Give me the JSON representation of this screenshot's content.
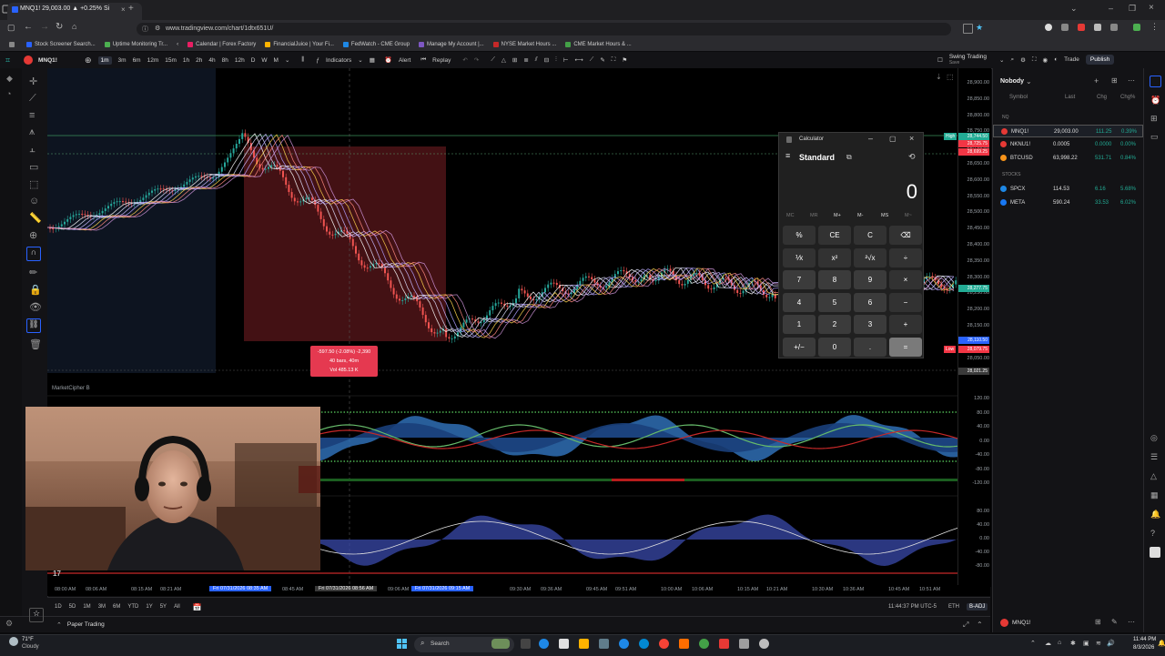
{
  "browser": {
    "tab_title": "MNQ1! 29,003.00 ▲ +0.25% Si",
    "url": "www.tradingview.com/chart/1dtx651U/",
    "bookmarks": [
      "Stock Screener Search...",
      "Uptime Monitoring Tr...",
      "Calendar | Forex Factory",
      "FinancialJuice | Your Fi...",
      "FedWatch - CME Group",
      "Manage My Account |...",
      "NYSE Market Hours ...",
      "CME Market Hours & ..."
    ],
    "bookmark_colors": [
      "#2962ff",
      "#4caf50",
      "#e91e63",
      "#ffb300",
      "#1e88e5",
      "#7e57c2",
      "#c62828",
      "#43a047"
    ]
  },
  "toolbar": {
    "symbol": "MNQ1!",
    "intervals": [
      "1m",
      "3m",
      "6m",
      "12m",
      "15m",
      "1h",
      "2h",
      "4h",
      "8h",
      "12h",
      "D",
      "W",
      "M"
    ],
    "indicators_label": "Indicators",
    "alert_label": "Alert",
    "replay_label": "Replay",
    "layout_name": "Swing Trading",
    "layout_sub": "Save",
    "trade_label": "Trade",
    "publish_label": "Publish"
  },
  "chart": {
    "price_ticks": [
      "28,900.00",
      "28,850.00",
      "28,800.00",
      "28,750.00",
      "28,700.00",
      "28,650.00",
      "28,600.00",
      "28,550.00",
      "28,500.00",
      "28,450.00",
      "28,400.00",
      "28,350.00",
      "28,300.00",
      "28,250.00",
      "28,200.00",
      "28,150.00",
      "28,100.00",
      "28,050.00"
    ],
    "price_badges": [
      {
        "text": "28,744.50",
        "color": "#22ab94",
        "label": "High"
      },
      {
        "text": "28,725.75",
        "color": "#f23645",
        "label": ""
      },
      {
        "text": "28,699.25",
        "color": "#f23645",
        "label": ""
      },
      {
        "text": "28,277.75",
        "color": "#22ab94",
        "label": ""
      },
      {
        "text": "28,110.50",
        "color": "#2962ff",
        "label": ""
      },
      {
        "text": "28,079.75",
        "color": "#f23645",
        "label": "Low"
      },
      {
        "text": "28,021.25",
        "color": "#3a3a3a",
        "label": ""
      }
    ],
    "measure_line1": "-597.50 (-2.08%) -2,390",
    "measure_line2": "40 bars, 40m",
    "measure_line3": "Vol 485.13 K",
    "indicator_name": "MarketCipher B",
    "osc_ticks_1": [
      "120.00",
      "80.00",
      "40.00",
      "0.00",
      "-40.00",
      "-80.00",
      "-120.00"
    ],
    "osc_ticks_2": [
      "80.00",
      "40.00",
      "0.00",
      "-40.00",
      "-80.00"
    ],
    "time_labels": [
      "08:00 AM",
      "08:06 AM",
      "08:15 AM",
      "08:21 AM",
      "08:45 AM",
      "09:30 AM",
      "09:36 AM",
      "09:45 AM",
      "09:51 AM",
      "10:00 AM",
      "10:06 AM",
      "10:15 AM",
      "10:21 AM",
      "10:30 AM",
      "10:36 AM",
      "10:45 AM",
      "10:51 AM"
    ],
    "time_highlight_1": "Fri 07/31/2026   08:35 AM",
    "time_highlight_2": "Fri 07/31/2026   08:56 AM",
    "time_highlight_3": "Fri 07/31/2026   09:15 AM",
    "time_highlight_mid": "09:06 AM"
  },
  "bottom": {
    "ranges": [
      "1D",
      "5D",
      "1M",
      "3M",
      "6M",
      "YTD",
      "1Y",
      "5Y",
      "All"
    ],
    "clock": "11:44:37 PM UTC-5",
    "session": "ETH",
    "adj": "B-ADJ",
    "paper_trading": "Paper Trading"
  },
  "watchlist": {
    "title": "Nobody",
    "headers": [
      "Symbol",
      "Last",
      "Chg",
      "Chg%"
    ],
    "section_1": "NQ",
    "section_2": "STOCKS",
    "rows": [
      {
        "symbol": "MNQ1!",
        "last": "29,003.00",
        "chg": "111.25",
        "chgp": "0.39%",
        "up": true,
        "color": "#e53935"
      },
      {
        "symbol": "NKNU1!",
        "last": "0.0005",
        "chg": "0.0000",
        "chgp": "0.00%",
        "up": true,
        "color": "#e53935"
      },
      {
        "symbol": "BTCUSD",
        "last": "63,998.22",
        "chg": "531.71",
        "chgp": "0.84%",
        "up": true,
        "color": "#f7931a"
      },
      {
        "symbol": "SPCX",
        "last": "114.53",
        "chg": "6.16",
        "chgp": "5.68%",
        "up": true,
        "color": "#1e88e5"
      },
      {
        "symbol": "META",
        "last": "590.24",
        "chg": "33.53",
        "chgp": "6.02%",
        "up": true,
        "color": "#1877f2"
      }
    ],
    "footer_symbol": "MNQ1!"
  },
  "calculator": {
    "window_title": "Calculator",
    "mode": "Standard",
    "display": "0",
    "memory": [
      "MC",
      "MR",
      "M+",
      "M-",
      "MS",
      "M~"
    ],
    "keys": [
      [
        "%",
        "CE",
        "C",
        "⌫"
      ],
      [
        "⅟x",
        "x²",
        "²√x",
        "÷"
      ],
      [
        "7",
        "8",
        "9",
        "×"
      ],
      [
        "4",
        "5",
        "6",
        "−"
      ],
      [
        "1",
        "2",
        "3",
        "+"
      ],
      [
        "+/−",
        "0",
        ".",
        "="
      ]
    ]
  },
  "taskbar": {
    "weather_temp": "71°F",
    "weather_desc": "Cloudy",
    "search_label": "Search",
    "time": "11:44 PM",
    "date": "8/3/2026"
  },
  "colors": {
    "up": "#22ab94",
    "down": "#f23645",
    "accent": "#2962ff"
  }
}
